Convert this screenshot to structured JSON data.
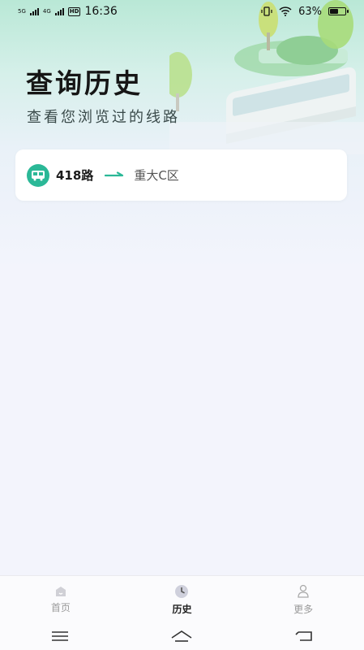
{
  "status_bar": {
    "network_1": "5G",
    "network_2": "4G",
    "hd_label": "HD",
    "time": "16:36",
    "battery_text": "63%",
    "battery_level": 0.63
  },
  "header": {
    "title": "查询历史",
    "subtitle": "查看您浏览过的线路"
  },
  "history": [
    {
      "route": "418路",
      "destination": "重大C区"
    }
  ],
  "tabs": [
    {
      "label": "首页",
      "icon": "home-icon",
      "active": false
    },
    {
      "label": "历史",
      "icon": "clock-icon",
      "active": true
    },
    {
      "label": "更多",
      "icon": "user-icon",
      "active": false
    }
  ],
  "colors": {
    "accent": "#2bb897",
    "header_gradient_top": "#b9e8d6"
  }
}
